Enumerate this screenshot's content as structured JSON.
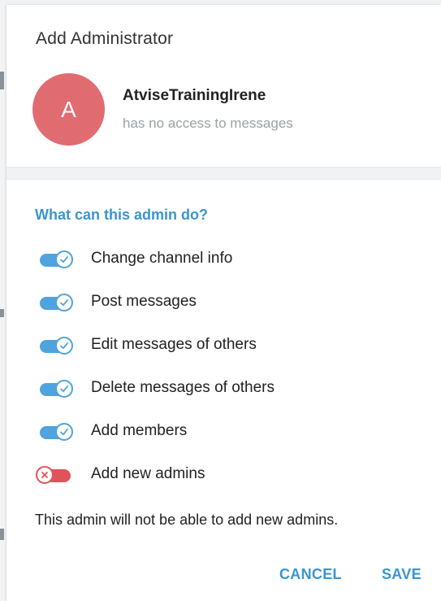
{
  "dialog": {
    "title": "Add Administrator"
  },
  "user": {
    "avatar_initial": "A",
    "avatar_color": "#e06c71",
    "name": "AtviseTrainingIrene",
    "status": "has no access to messages"
  },
  "permissions": {
    "section_title": "What can this admin do?",
    "items": [
      {
        "label": "Change channel info",
        "enabled": true
      },
      {
        "label": "Post messages",
        "enabled": true
      },
      {
        "label": "Edit messages of others",
        "enabled": true
      },
      {
        "label": "Delete messages of others",
        "enabled": true
      },
      {
        "label": "Add members",
        "enabled": true
      },
      {
        "label": "Add new admins",
        "enabled": false
      }
    ],
    "note": "This admin will not be able to add new admins."
  },
  "actions": {
    "cancel_label": "CANCEL",
    "save_label": "SAVE"
  },
  "colors": {
    "accent": "#3a95cf",
    "toggle_on": "#4fa3de",
    "toggle_off": "#e0535a"
  }
}
